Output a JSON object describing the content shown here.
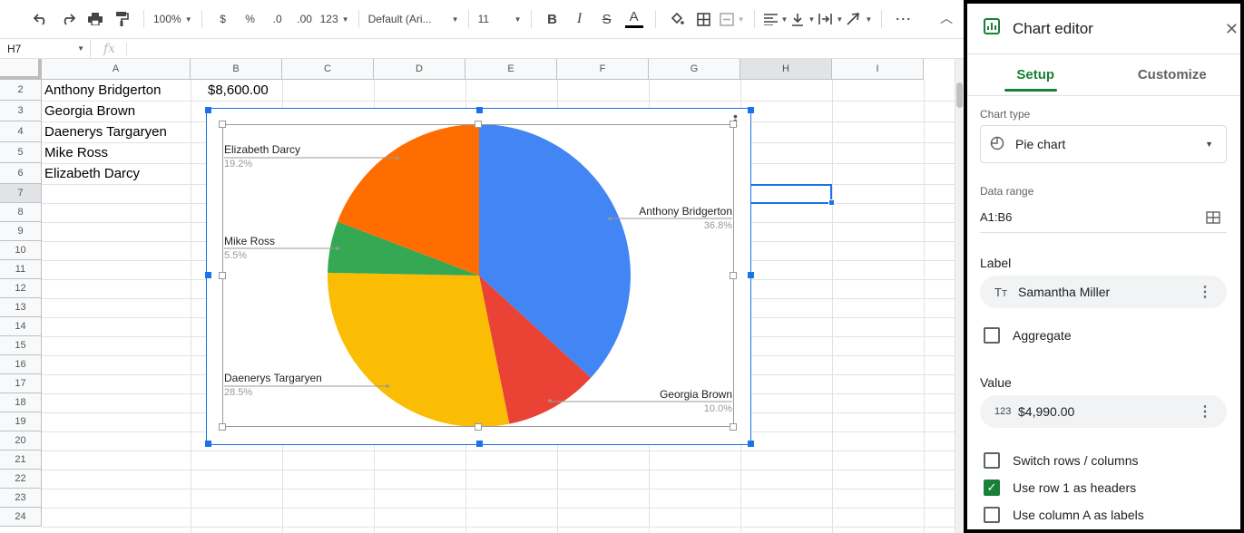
{
  "toolbar": {
    "zoom": "100%",
    "currency": "$",
    "percent": "%",
    "dec_less": ".0",
    "dec_more": ".00",
    "more_formats": "123",
    "font": "Default (Ari...",
    "font_size": "11",
    "bold": "B",
    "italic": "I",
    "strike": "S",
    "text_color": "A",
    "more": "⋯"
  },
  "formula_bar": {
    "cell_ref": "H7",
    "fx": "fx"
  },
  "columns": [
    "A",
    "B",
    "C",
    "D",
    "E",
    "F",
    "G",
    "H",
    "I"
  ],
  "rows": [
    "2",
    "3",
    "4",
    "5",
    "6",
    "7",
    "8",
    "9",
    "10",
    "11",
    "12",
    "13",
    "14",
    "15",
    "16",
    "17",
    "18",
    "19",
    "20",
    "21",
    "22",
    "23",
    "24"
  ],
  "cells": {
    "a2": "Anthony Bridgerton",
    "b2": "$8,600.00",
    "a3": "Georgia Brown",
    "a4": "Daenerys Targaryen",
    "a5": "Mike Ross",
    "a6": "Elizabeth Darcy"
  },
  "chart_data": {
    "type": "pie",
    "categories": [
      "Anthony Bridgerton",
      "Georgia Brown",
      "Daenerys Targaryen",
      "Mike Ross",
      "Elizabeth Darcy"
    ],
    "values": [
      36.8,
      10.0,
      28.5,
      5.5,
      19.2
    ],
    "labels": [
      "36.8%",
      "10.0%",
      "28.5%",
      "5.5%",
      "19.2%"
    ],
    "colors": [
      "#4285f4",
      "#ea4335",
      "#fbbc04",
      "#34a853",
      "#ff6d01"
    ],
    "legend": "labeled"
  },
  "editor": {
    "title": "Chart editor",
    "tabs": [
      "Setup",
      "Customize"
    ],
    "chart_type_label": "Chart type",
    "chart_type": "Pie chart",
    "data_range_label": "Data range",
    "data_range": "A1:B6",
    "label_section": "Label",
    "label_value": "Samantha Miller",
    "aggregate": "Aggregate",
    "value_section": "Value",
    "value_value": "$4,990.00",
    "switch_rows": "Switch rows / columns",
    "use_row1": "Use row 1 as headers",
    "use_colA": "Use column A as labels"
  }
}
